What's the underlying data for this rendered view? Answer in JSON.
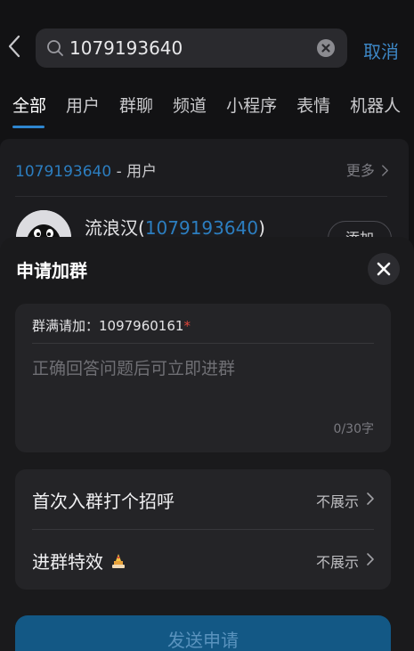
{
  "search": {
    "query": "1079193640",
    "cancel_label": "取消"
  },
  "tabs": [
    {
      "label": "全部",
      "active": true
    },
    {
      "label": "用户"
    },
    {
      "label": "群聊"
    },
    {
      "label": "频道"
    },
    {
      "label": "小程序"
    },
    {
      "label": "表情"
    },
    {
      "label": "机器人"
    }
  ],
  "result": {
    "query": "1079193640",
    "type_label": " - 用户",
    "more_label": "更多",
    "user": {
      "name_prefix": "流浪汉(",
      "name_highlight": "1079193640",
      "name_suffix": ")",
      "add_label": "添加"
    }
  },
  "sheet": {
    "title": "申请加群",
    "question_label": "群满请加：1097960161",
    "required_mark": "*",
    "answer_placeholder": "正确回答问题后可立即进群",
    "char_count": "0/30字",
    "options": [
      {
        "label": "首次入群打个招呼",
        "value": "不展示"
      },
      {
        "label": "进群特效",
        "value": "不展示",
        "icon": "firework-effect-icon"
      }
    ],
    "send_label": "发送申请"
  },
  "colors": {
    "accent": "#2e86d0",
    "link": "#2c7ec0",
    "required": "#e0463a",
    "send_button": "#135885"
  }
}
